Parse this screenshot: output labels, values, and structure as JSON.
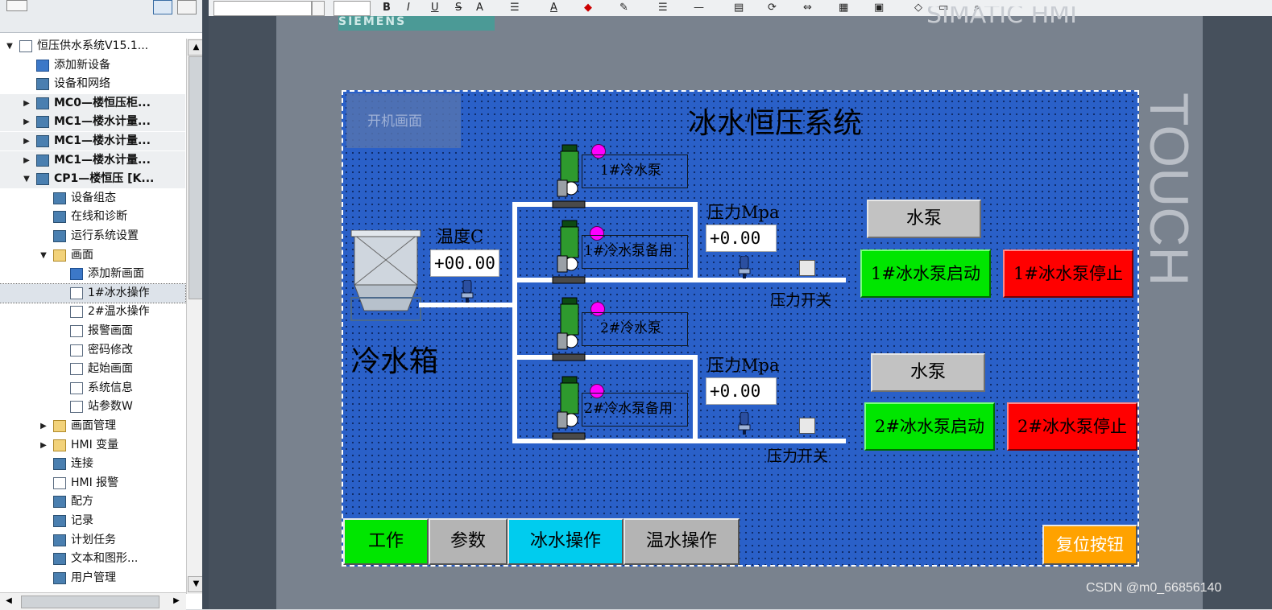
{
  "tree": {
    "items": [
      {
        "label": "恒压供水系统V15.1...",
        "level": 0,
        "expanded": true,
        "icon": "project-icon"
      },
      {
        "label": "添加新设备",
        "level": 1,
        "icon": "add-device-icon"
      },
      {
        "label": "设备和网络",
        "level": 1,
        "icon": "network-icon"
      },
      {
        "label": "MC0—楼恒压柜...",
        "level": 1,
        "collapsed": true,
        "icon": "plc-icon"
      },
      {
        "label": "MC1—楼水计量...",
        "level": 1,
        "collapsed": true,
        "icon": "plc-icon"
      },
      {
        "label": "MC1—楼水计量...",
        "level": 1,
        "collapsed": true,
        "icon": "plc-icon"
      },
      {
        "label": "MC1—楼水计量...",
        "level": 1,
        "collapsed": true,
        "icon": "plc-icon"
      },
      {
        "label": "CP1—楼恒压 [K...",
        "level": 1,
        "expanded": true,
        "icon": "hmi-device-icon"
      },
      {
        "label": "设备组态",
        "level": 2,
        "icon": "device-config-icon"
      },
      {
        "label": "在线和诊断",
        "level": 2,
        "icon": "diagnostics-icon"
      },
      {
        "label": "运行系统设置",
        "level": 2,
        "icon": "runtime-settings-icon"
      },
      {
        "label": "画面",
        "level": 2,
        "expanded": true,
        "icon": "folder-icon"
      },
      {
        "label": "添加新画面",
        "level": 3,
        "icon": "add-screen-icon"
      },
      {
        "label": "1#冰水操作",
        "level": 3,
        "selected": true,
        "icon": "screen-icon"
      },
      {
        "label": "2#温水操作",
        "level": 3,
        "icon": "screen-icon"
      },
      {
        "label": "报警画面",
        "level": 3,
        "icon": "screen-icon"
      },
      {
        "label": "密码修改",
        "level": 3,
        "icon": "screen-icon"
      },
      {
        "label": "起始画面",
        "level": 3,
        "icon": "start-screen-icon"
      },
      {
        "label": "系统信息",
        "level": 3,
        "icon": "screen-icon"
      },
      {
        "label": "站参数W",
        "level": 3,
        "icon": "screen-icon"
      },
      {
        "label": "画面管理",
        "level": 2,
        "collapsed": true,
        "icon": "folder-icon"
      },
      {
        "label": "HMI 变量",
        "level": 2,
        "collapsed": true,
        "icon": "folder-icon"
      },
      {
        "label": "连接",
        "level": 2,
        "icon": "connection-icon"
      },
      {
        "label": "HMI 报警",
        "level": 2,
        "icon": "alarm-icon"
      },
      {
        "label": "配方",
        "level": 2,
        "icon": "recipe-icon"
      },
      {
        "label": "记录",
        "level": 2,
        "icon": "log-icon"
      },
      {
        "label": "计划任务",
        "level": 2,
        "icon": "scheduler-icon"
      },
      {
        "label": "文本和图形...",
        "level": 2,
        "icon": "text-graphics-icon"
      },
      {
        "label": "用户管理",
        "level": 2,
        "icon": "user-admin-icon"
      }
    ]
  },
  "toolbar": {
    "bold": "B",
    "italic": "I",
    "underline": "U",
    "strike": "S",
    "font_color": "A",
    "font_color2": "A"
  },
  "device": {
    "brand": "SIEMENS",
    "model": "SIMATIC HMI",
    "touch": "TOUCH"
  },
  "screen": {
    "title": "冰水恒压系统",
    "start_screen_btn": "开机画面",
    "tank_label": "冷水箱",
    "temp_label": "温度C",
    "temp_value": "+00.00",
    "pumps": [
      {
        "label": "1#冷水泵"
      },
      {
        "label": "1#冷水泵备用"
      },
      {
        "label": "2#冷水泵"
      },
      {
        "label": "2#冷水泵备用"
      }
    ],
    "groups": [
      {
        "pressure_label": "压力Mpa",
        "pressure_value": "+0.00",
        "switch_label": "压力开关",
        "pump_btn": "水泵",
        "start_btn": "1#冰水泵启动",
        "stop_btn": "1#冰水泵停止"
      },
      {
        "pressure_label": "压力Mpa",
        "pressure_value": "+0.00",
        "switch_label": "压力开关",
        "pump_btn": "水泵",
        "start_btn": "2#冰水泵启动",
        "stop_btn": "2#冰水泵停止"
      }
    ],
    "nav": [
      {
        "label": "工作",
        "color": "#00e600"
      },
      {
        "label": "参数",
        "color": "#b4b4b4"
      },
      {
        "label": "冰水操作",
        "color": "#00ccee"
      },
      {
        "label": "温水操作",
        "color": "#b4b4b4"
      }
    ],
    "reset_btn": "复位按钮",
    "reset_color": "#ffa200"
  },
  "watermark": "CSDN @m0_66856140"
}
